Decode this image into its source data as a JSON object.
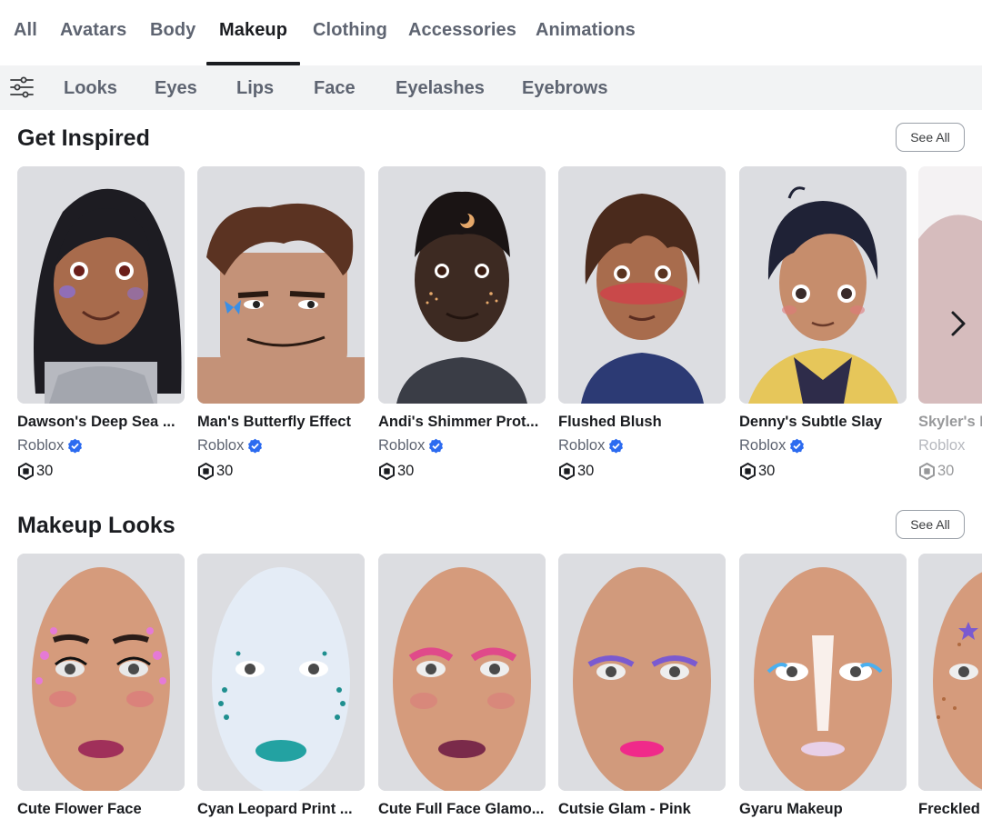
{
  "top_tabs": [
    "All",
    "Avatars",
    "Body",
    "Makeup",
    "Clothing",
    "Accessories",
    "Animations"
  ],
  "active_top_tab": "Makeup",
  "sub_tabs": [
    "Looks",
    "Eyes",
    "Lips",
    "Face",
    "Eyelashes",
    "Eyebrows"
  ],
  "sections": [
    {
      "title": "Get Inspired",
      "see_all_label": "See All",
      "items": [
        {
          "title": "Dawson's Deep Sea ...",
          "creator": "Roblox",
          "price": "30"
        },
        {
          "title": "Man's Butterfly Effect",
          "creator": "Roblox",
          "price": "30"
        },
        {
          "title": "Andi's Shimmer Prot...",
          "creator": "Roblox",
          "price": "30"
        },
        {
          "title": "Flushed Blush",
          "creator": "Roblox",
          "price": "30"
        },
        {
          "title": "Denny's Subtle Slay",
          "creator": "Roblox",
          "price": "30"
        },
        {
          "title": "Skyler's L",
          "creator": "Roblox",
          "price": "30"
        }
      ]
    },
    {
      "title": "Makeup Looks",
      "see_all_label": "See All",
      "items": [
        {
          "title": "Cute Flower Face"
        },
        {
          "title": "Cyan Leopard Print ..."
        },
        {
          "title": "Cute Full Face Glamo..."
        },
        {
          "title": "Cutsie Glam - Pink"
        },
        {
          "title": "Gyaru Makeup"
        },
        {
          "title": "Freckled"
        }
      ]
    }
  ],
  "colors": {
    "accent": "#1b1d21",
    "muted_text": "#5e6471",
    "verified_badge": "#2c6bf0",
    "subbar_bg": "#f2f3f4"
  },
  "icons": {
    "filter": "sliders-icon",
    "verified": "verified-badge-icon",
    "currency": "robux-icon",
    "next": "chevron-right-icon"
  }
}
